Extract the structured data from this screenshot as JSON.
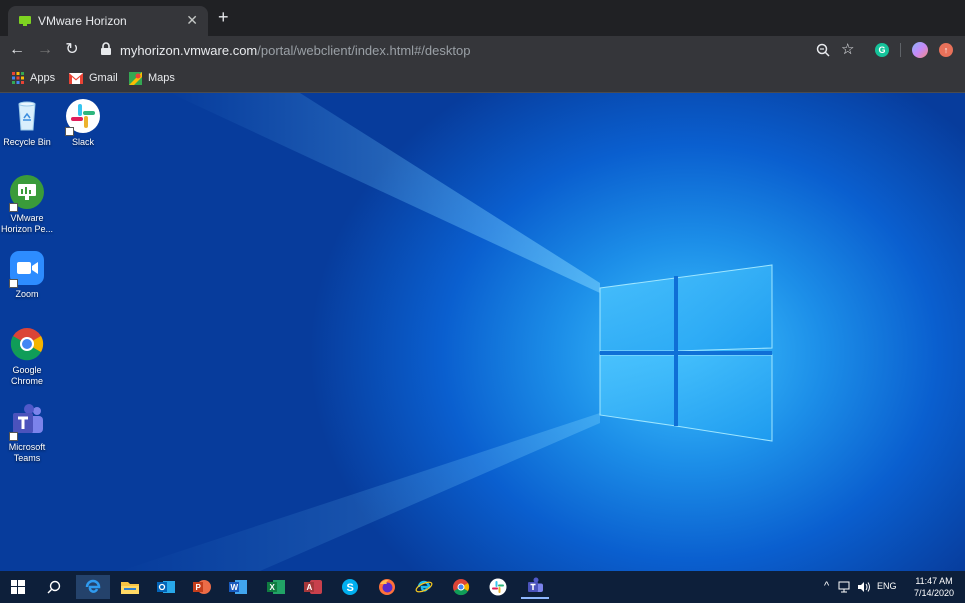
{
  "browser": {
    "tab_title": "VMware Horizon",
    "url_host": "myhorizon.vmware.com",
    "url_path": "/portal/webclient/index.html#/desktop",
    "bookmarks": [
      "Apps",
      "Gmail",
      "Maps"
    ]
  },
  "desktop_icons": [
    {
      "label": "Recycle Bin"
    },
    {
      "label": "Slack"
    },
    {
      "label": "VMware Horizon Pe..."
    },
    {
      "label": "Zoom"
    },
    {
      "label": "Google Chrome"
    },
    {
      "label": "Microsoft Teams"
    }
  ],
  "taskbar": {
    "language": "ENG",
    "time": "11:47 AM",
    "date": "7/14/2020"
  },
  "colors": {
    "accent": "#1a73e8",
    "taskbar_bg": "#0d1f3a"
  }
}
